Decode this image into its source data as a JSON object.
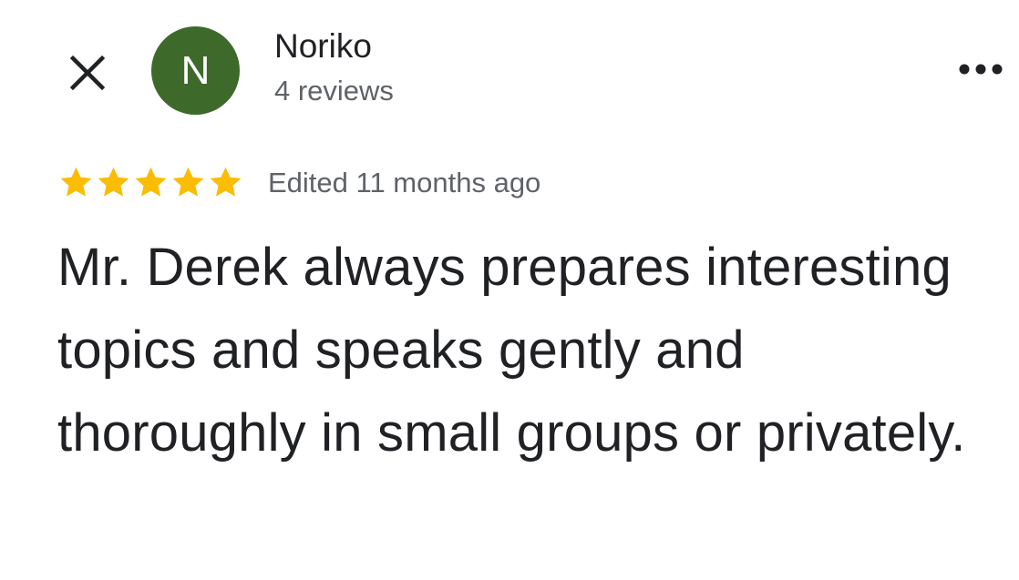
{
  "header": {
    "close_icon": "close-icon",
    "more_icon": "more-horizontal-icon"
  },
  "author": {
    "avatar_initial": "N",
    "avatar_color": "#3d6a2a",
    "name": "Noriko",
    "reviews": "4 reviews"
  },
  "review": {
    "rating": 5,
    "rating_max": 5,
    "star_color": "#fbbc04",
    "edited": "Edited 11 months ago",
    "text": "Mr. Derek always prepares interesting topics and speaks gently and thoroughly in small groups or privately."
  }
}
